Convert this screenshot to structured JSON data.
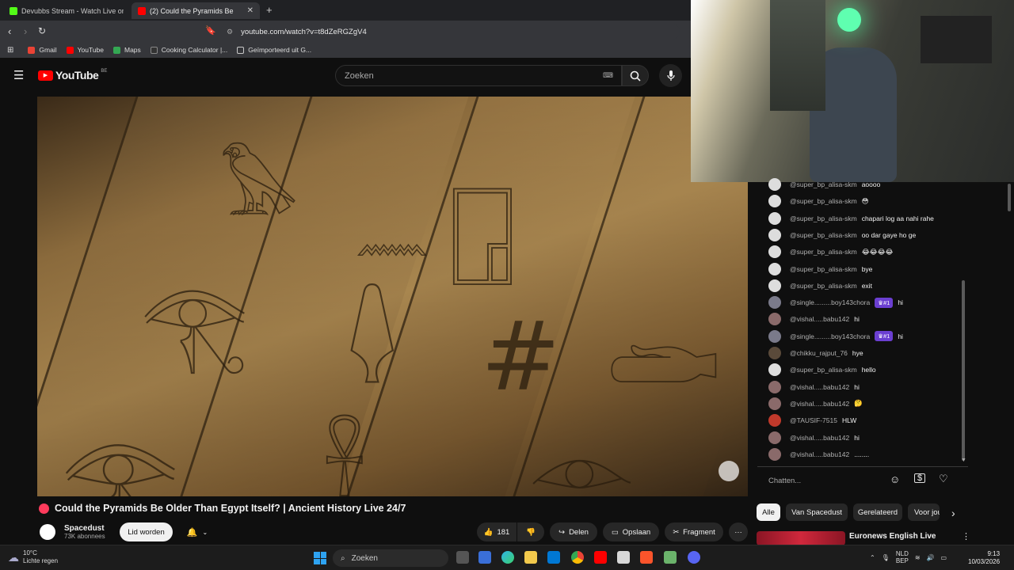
{
  "browser": {
    "tabs": [
      {
        "title": "Devubbs Stream - Watch Live on",
        "active": false,
        "favicon_color": "#53fc18"
      },
      {
        "title": "(2)   Could the Pyramids Be",
        "active": true,
        "favicon_color": "#ff0000"
      }
    ],
    "new_tab": "+",
    "url": "youtube.com/watch?v=t8dZeRGZgV4",
    "bookmarks": [
      {
        "label": "Gmail",
        "color": "#ea4335"
      },
      {
        "label": "YouTube",
        "color": "#ff0000"
      },
      {
        "label": "Maps",
        "color": "#34a853"
      },
      {
        "label": "Cooking Calculator |...",
        "color": "#333333"
      },
      {
        "label": "Geïmporteerd uit G...",
        "color": "#c8c8c8"
      }
    ]
  },
  "youtube": {
    "logo_text": "YouTube",
    "logo_country": "BE",
    "search_placeholder": "Zoeken"
  },
  "video": {
    "title": "Could the Pyramids Be Older Than Egypt Itself? | Ancient History Live 24/7",
    "channel": "Spacedust",
    "subscribers": "73K abonnees",
    "join_label": "Lid worden",
    "likes": "181",
    "share_label": "Delen",
    "save_label": "Opslaan",
    "clip_label": "Fragment",
    "more_label": "···"
  },
  "chat": {
    "messages": [
      {
        "author": "@super_bp_alisa-skm",
        "text": "aoooo",
        "avatar": "#dddddd"
      },
      {
        "author": "@super_bp_alisa-skm",
        "text": "😳",
        "avatar": "#dddddd"
      },
      {
        "author": "@super_bp_alisa-skm",
        "text": "chapari log aa nahi rahe",
        "avatar": "#dddddd"
      },
      {
        "author": "@super_bp_alisa-skm",
        "text": "oo dar gaye ho ge",
        "avatar": "#dddddd"
      },
      {
        "author": "@super_bp_alisa-skm",
        "text": "😂😂😂😂",
        "avatar": "#dddddd"
      },
      {
        "author": "@super_bp_alisa-skm",
        "text": "bye",
        "avatar": "#dddddd"
      },
      {
        "author": "@super_bp_alisa-skm",
        "text": "exit",
        "avatar": "#dddddd"
      },
      {
        "author": "@single.........boy143chora",
        "badge": "♛#1",
        "text": "hi",
        "avatar": "#7a7a8a"
      },
      {
        "author": "@vishal.....babu142",
        "text": "hi",
        "avatar": "#8a6a6a"
      },
      {
        "author": "@single.........boy143chora",
        "badge": "♛#1",
        "text": "hi",
        "avatar": "#7a7a8a"
      },
      {
        "author": "@chikku_rajput_76",
        "text": "hye",
        "avatar": "#5a4a3a"
      },
      {
        "author": "@super_bp_alisa-skm",
        "text": "hello",
        "avatar": "#dddddd"
      },
      {
        "author": "@vishal.....babu142",
        "text": "hi",
        "avatar": "#8a6a6a"
      },
      {
        "author": "@vishal.....babu142",
        "text": "🤔",
        "avatar": "#8a6a6a"
      },
      {
        "author": "@TAUSIF-7515",
        "text": "HLW",
        "avatar": "#c0392b"
      },
      {
        "author": "@vishal.....babu142",
        "text": "hi",
        "avatar": "#8a6a6a"
      },
      {
        "author": "@vishal.....babu142",
        "text": "........",
        "avatar": "#8a6a6a"
      }
    ],
    "input_placeholder": "Chatten..."
  },
  "chips": {
    "items": [
      "Alle",
      "Van Spacedust",
      "Gerelateerd",
      "Voor jou"
    ],
    "selected": "Alle"
  },
  "recommendation": {
    "title": "Euronews English Live"
  },
  "taskbar": {
    "temperature": "10°C",
    "weather": "Lichte regen",
    "search_label": "Zoeken",
    "lang_top": "NLD",
    "lang_bottom": "BEP",
    "time": "9:13",
    "date": "10/03/2026"
  }
}
